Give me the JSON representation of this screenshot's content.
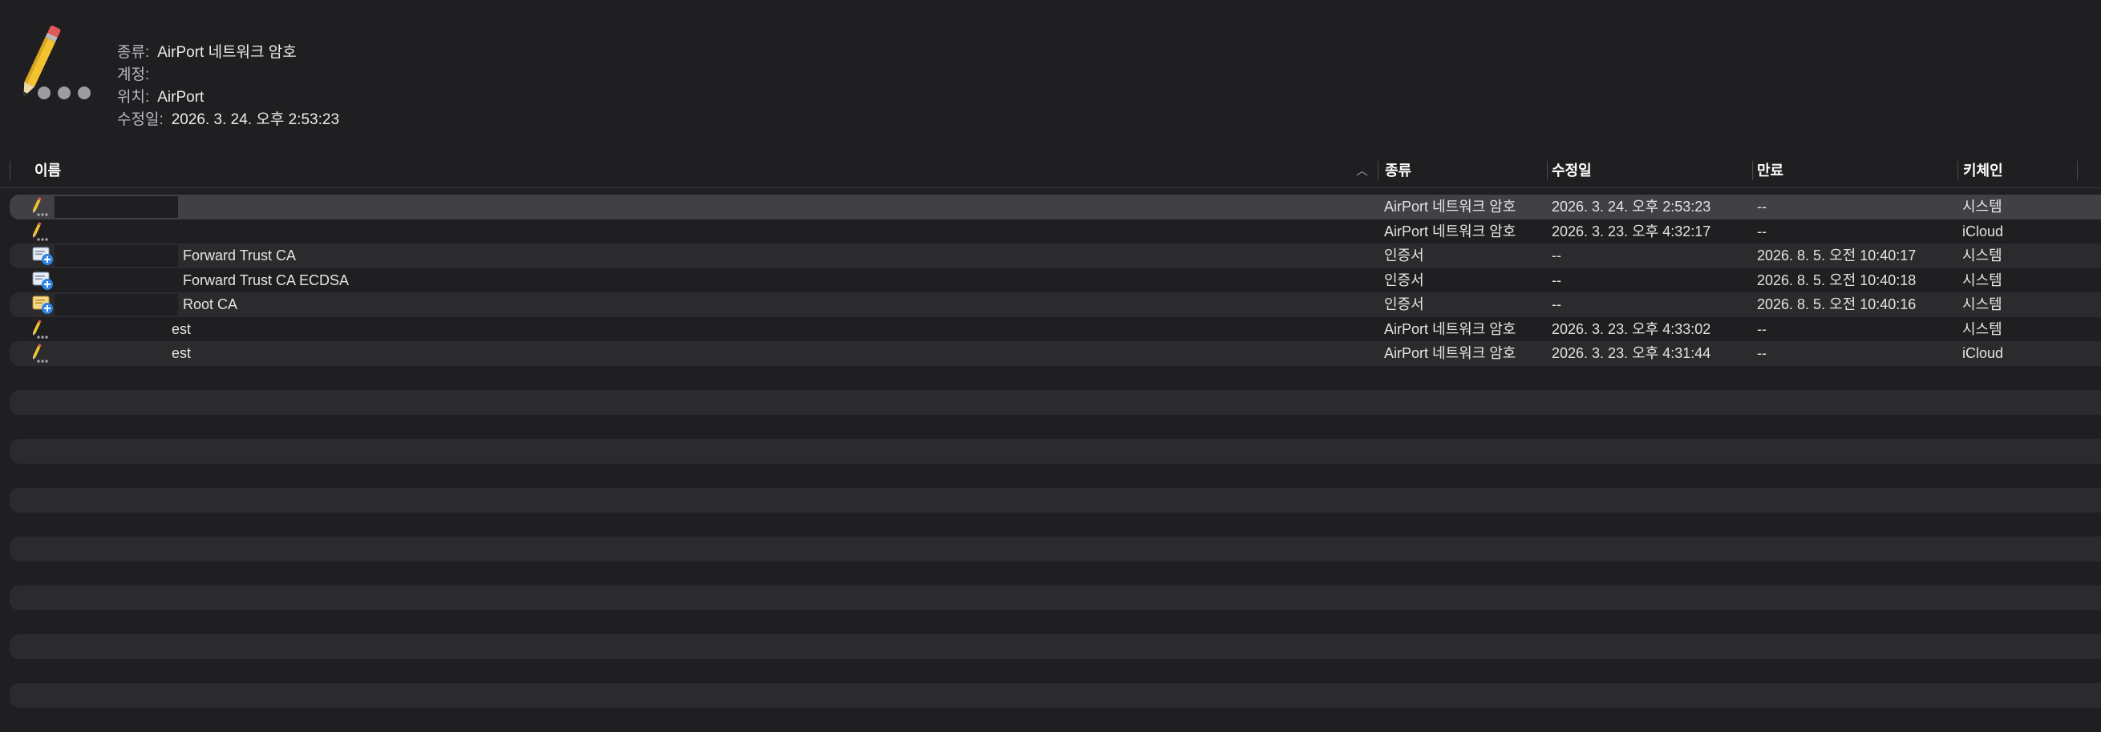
{
  "inspector": {
    "icon": "pencil-key-icon",
    "kind_label": "종류:",
    "kind_value": "AirPort 네트워크 암호",
    "account_label": "계정:",
    "account_value": "",
    "where_label": "위치:",
    "where_value": "AirPort",
    "modified_label": "수정일:",
    "modified_value": "2026. 3. 24. 오후 2:53:23"
  },
  "columns": {
    "name": "이름",
    "kind": "종류",
    "modified": "수정일",
    "expires": "만료",
    "keychain": "키체인"
  },
  "rows": [
    {
      "icon": "pencil-icon",
      "name": "",
      "kind": "AirPort 네트워크 암호",
      "modified": "2026. 3. 24. 오후 2:53:23",
      "expires": "--",
      "keychain": "시스템",
      "selected": true
    },
    {
      "icon": "pencil-icon",
      "name": "",
      "kind": "AirPort 네트워크 암호",
      "modified": "2026. 3. 23. 오후 4:32:17",
      "expires": "--",
      "keychain": "iCloud"
    },
    {
      "icon": "certificate-icon",
      "name": "Forward Trust CA",
      "kind": "인증서",
      "modified": "--",
      "expires": "2026. 8. 5. 오전 10:40:17",
      "keychain": "시스템"
    },
    {
      "icon": "certificate-icon",
      "name": "Forward Trust CA ECDSA",
      "kind": "인증서",
      "modified": "--",
      "expires": "2026. 8. 5. 오전 10:40:18",
      "keychain": "시스템"
    },
    {
      "icon": "certificate-root-icon",
      "name": "Root CA",
      "kind": "인증서",
      "modified": "--",
      "expires": "2026. 8. 5. 오전 10:40:16",
      "keychain": "시스템"
    },
    {
      "icon": "pencil-icon",
      "name": "est",
      "kind": "AirPort 네트워크 암호",
      "modified": "2026. 3. 23. 오후 4:33:02",
      "expires": "--",
      "keychain": "시스템"
    },
    {
      "icon": "pencil-icon",
      "name": "est",
      "kind": "AirPort 네트워크 암호",
      "modified": "2026. 3. 23. 오후 4:31:44",
      "keychain": "iCloud",
      "expires": "--"
    }
  ]
}
